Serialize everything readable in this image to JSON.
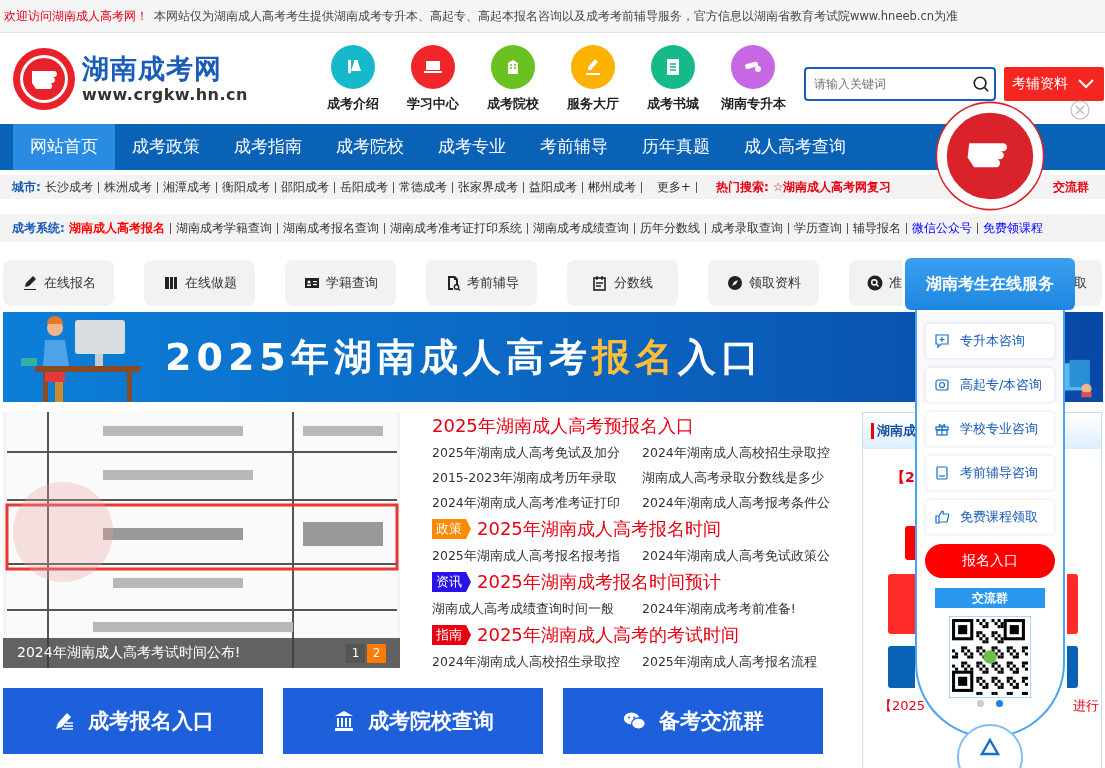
{
  "top_bar": {
    "welcome": "欢迎访问湖南成人高考网！",
    "notice": "本网站仅为湖南成人高考考生提供湖南成考专升本、高起专、高起本报名咨询以及成考考前辅导服务，官方信息以湖南省教育考试院www.hneeb.cn为准"
  },
  "header": {
    "site_name": "湖南成考网",
    "site_url": "www.crgkw.hn.cn",
    "quick_links": [
      {
        "label": "成考介绍",
        "color": "#17b7cc",
        "kind": "flask"
      },
      {
        "label": "学习中心",
        "color": "#f0262a",
        "kind": "laptop"
      },
      {
        "label": "成考院校",
        "color": "#6cc122",
        "kind": "building"
      },
      {
        "label": "服务大厅",
        "color": "#fdb200",
        "kind": "pen"
      },
      {
        "label": "成考书城",
        "color": "#16b98a",
        "kind": "list"
      },
      {
        "label": "湖南专升本",
        "color": "#c867e6",
        "kind": "diploma"
      }
    ],
    "search": {
      "placeholder": "请输入关键词"
    },
    "materials_button": "考辅资料"
  },
  "nav": [
    {
      "label": "网站首页",
      "selected": true
    },
    {
      "label": "成考政策",
      "selected": false
    },
    {
      "label": "成考指南",
      "selected": false
    },
    {
      "label": "成考院校",
      "selected": false
    },
    {
      "label": "成考专业",
      "selected": false
    },
    {
      "label": "考前辅导",
      "selected": false
    },
    {
      "label": "历年真题",
      "selected": false
    },
    {
      "label": "成人高考查询",
      "selected": false
    }
  ],
  "city_row": {
    "label": "城市:",
    "cities": [
      "长沙成考",
      "株洲成考",
      "湘潭成考",
      "衡阳成考",
      "邵阳成考",
      "岳阳成考",
      "常德成考",
      "张家界成考",
      "益阳成考",
      "郴州成考"
    ],
    "more": "更多+",
    "hot_label": "热门搜索:",
    "hot_start": "☆湖南成人高考网复习",
    "hot_end": "交流群"
  },
  "system_row": {
    "label": "成考系统:",
    "links": [
      {
        "text": "湖南成人高考报名",
        "kind": "hot"
      },
      {
        "text": "湖南成考学籍查询",
        "kind": "plain"
      },
      {
        "text": "湖南成考报名查询",
        "kind": "plain"
      },
      {
        "text": "湖南成考准考证打印系统",
        "kind": "plain"
      },
      {
        "text": "湖南成考成绩查询",
        "kind": "plain"
      },
      {
        "text": "历年分数线",
        "kind": "plain"
      },
      {
        "text": "成考录取查询",
        "kind": "plain"
      },
      {
        "text": "学历查询",
        "kind": "plain"
      },
      {
        "text": "辅导报名",
        "kind": "plain"
      },
      {
        "text": "微信公众号",
        "kind": "promo"
      },
      {
        "text": "免费领课程",
        "kind": "promo"
      }
    ]
  },
  "service_buttons": [
    {
      "label": "在线报名",
      "kind": "pen"
    },
    {
      "label": "在线做题",
      "kind": "book"
    },
    {
      "label": "学籍查询",
      "kind": "card"
    },
    {
      "label": "考前辅导",
      "kind": "doc"
    },
    {
      "label": "分数线",
      "kind": "calendar"
    },
    {
      "label": "领取资料",
      "kind": "compass"
    }
  ],
  "covered_button": {
    "kind": "search",
    "start": "准",
    "end": "取"
  },
  "banner": {
    "lead": "2025年湖南成人高考",
    "highlight": "报名",
    "tail": "入口"
  },
  "slideshow": {
    "caption": "2024年湖南成人高考考试时间公布!",
    "pages": [
      {
        "label": "1",
        "selected": false
      },
      {
        "label": "2",
        "selected": true
      }
    ]
  },
  "news": [
    {
      "title": "2025年湖南成人高考预报名入口",
      "links": [
        "2025年湖南成人高考免试及加分",
        "2024年湖南成人高校招生录取控",
        "2015-2023年湖南成考历年录取",
        "湖南成人高考录取分数线是多少",
        "2024年湖南成人高考准考证打印",
        "2024年湖南成人高考报考条件公"
      ]
    },
    {
      "tag": "政策",
      "color": "#ff8a00",
      "title": "2025年湖南成人高考报名时间",
      "links": [
        "2025年湖南成人高考报名报考指",
        "2024年湖南成人高考免试政策公"
      ]
    },
    {
      "tag": "资讯",
      "color": "#2a12e8",
      "title": "2025年湖南成考报名时间预计",
      "links": [
        "湖南成人高考成绩查询时间一般",
        "2024年湖南成考考前准备!"
      ]
    },
    {
      "tag": "指南",
      "color": "#e60012",
      "title": "2025年湖南成人高考的考试时间",
      "links": [
        "2024年湖南成人高校招生录取控",
        "2025年湖南成人高考报名流程"
      ]
    }
  ],
  "sidebar": {
    "title": "湖南成",
    "notice": "【2",
    "footer_start": "【2025",
    "footer_end": "进行"
  },
  "bottom_buttons": [
    {
      "label": "成考报名入口",
      "kind": "pen"
    },
    {
      "label": "成考院校查询",
      "kind": "bank"
    },
    {
      "label": "备考交流群",
      "kind": "chat"
    }
  ],
  "service_panel": {
    "title": "湖南考生在线服务",
    "items": [
      {
        "label": "专升本咨询",
        "kind": "plus"
      },
      {
        "label": "高起专/本咨询",
        "kind": "badge"
      },
      {
        "label": "学校专业咨询",
        "kind": "gift"
      },
      {
        "label": "考前辅导咨询",
        "kind": "book"
      },
      {
        "label": "免费课程领取",
        "kind": "thumb"
      }
    ],
    "signup_button": "报名入口",
    "group_title": "交流群",
    "slides": [
      {
        "selected": false
      },
      {
        "selected": true
      }
    ]
  }
}
